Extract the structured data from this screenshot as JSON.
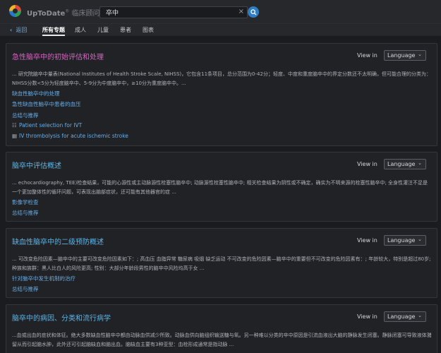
{
  "header": {
    "brand": "UpToDate",
    "brand_sup": "®",
    "brand_sub": "临床顾问",
    "search_value": "卒中",
    "clear_symbol": "×"
  },
  "nav": {
    "back": "返回",
    "tabs": [
      "所有专题",
      "成人",
      "儿童",
      "患者",
      "图表"
    ],
    "active_tab": 0
  },
  "colors": {
    "accent": "#2f7ec4",
    "link": "#6aaee8",
    "title_pink": "#e35cc8",
    "title_blue": "#5ab4e8"
  },
  "view_in_label": "View in",
  "language_value": "Language",
  "results": [
    {
      "title": "急性脑卒中的初始评估和处理",
      "snippet": "... 研究院脑卒中量表(National Institutes of Health Stroke Scale, NIHSS)，它包含11条项目，总分范围为0-42分；轻度、中度和重度脑卒中的界定分数还不太明确，但可能合理的分类为：NIHSS分数<5分为轻度脑卒中、5-9分为中度脑卒中，≥10分为重度脑卒中。...",
      "links": [
        {
          "icon": "",
          "text": "缺血性脑卒中的处理"
        },
        {
          "icon": "",
          "text": "急性缺血性脑卒中患者的血压"
        },
        {
          "icon": "",
          "text": "总结与推荐"
        },
        {
          "icon": "flowchart-icon",
          "text": "Patient selection for IVT"
        },
        {
          "icon": "table-icon",
          "text": "IV thrombolysis for acute ischemic stroke"
        }
      ]
    },
    {
      "title": "脑卒中评估概述",
      "snippet": "... echocardiography, TEE)检查结果，可能的心源性或主动脉源性栓塞性脑卒中; 动脉源性栓塞性脑卒中; 相关检查结果为阴性或不确定，确实为不明来源的栓塞性脑卒中; 全身性灌注不足是一个更加整体性的循环问题，可表现出脑部症状，还可能有其他器官的症 ...",
      "links": [
        {
          "icon": "",
          "text": "影像学检查"
        },
        {
          "icon": "",
          "text": "总结与推荐"
        }
      ]
    },
    {
      "title": "缺血性脑卒中的二级预防概述",
      "snippet": "... 可改变危险因素—脑卒中的主要可改变危险因素如下：; 高血压 血脂异常 糖尿病 吸烟 缺乏运动 不可改变的危险因素—脑卒中的重要但不可改变的危险因素有：; 年龄较大，特别是超过80岁; 种族和族群：黑人比白人的风险更高; 性别：大部分年龄段男性的脑卒中风险均高于女 ...",
      "links": [
        {
          "icon": "",
          "text": "针对脑卒中发生机制的治疗"
        },
        {
          "icon": "",
          "text": "总结与推荐"
        }
      ]
    },
    {
      "title": "脑卒中的病因、分类和流行病学",
      "snippet": "...血或出血的症状和体征。绝大多数缺血性脑卒中都由动脉血供减少所致。动脉血供向脑组织输送糖与氧。另一种难以分类的卒中原因是引流血液出大脑的静脉发生闭塞。静脉闭塞可导致液体潴留从而引起脑水肿，此外还可引起脑缺血和脑出血。脑缺血主要有3种亚型：血栓形成通常是指动脉 ...",
      "links": []
    }
  ]
}
